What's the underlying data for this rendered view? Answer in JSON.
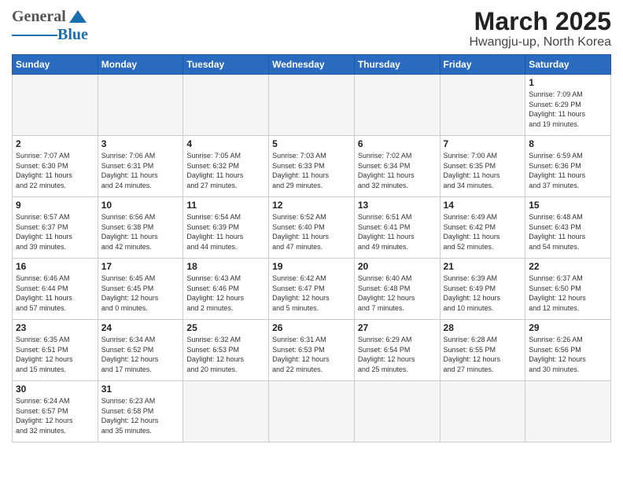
{
  "header": {
    "logo_general": "General",
    "logo_blue": "Blue",
    "title": "March 2025",
    "subtitle": "Hwangju-up, North Korea"
  },
  "weekdays": [
    "Sunday",
    "Monday",
    "Tuesday",
    "Wednesday",
    "Thursday",
    "Friday",
    "Saturday"
  ],
  "weeks": [
    [
      {
        "day": "",
        "info": ""
      },
      {
        "day": "",
        "info": ""
      },
      {
        "day": "",
        "info": ""
      },
      {
        "day": "",
        "info": ""
      },
      {
        "day": "",
        "info": ""
      },
      {
        "day": "",
        "info": ""
      },
      {
        "day": "1",
        "info": "Sunrise: 7:09 AM\nSunset: 6:29 PM\nDaylight: 11 hours\nand 19 minutes."
      }
    ],
    [
      {
        "day": "2",
        "info": "Sunrise: 7:07 AM\nSunset: 6:30 PM\nDaylight: 11 hours\nand 22 minutes."
      },
      {
        "day": "3",
        "info": "Sunrise: 7:06 AM\nSunset: 6:31 PM\nDaylight: 11 hours\nand 24 minutes."
      },
      {
        "day": "4",
        "info": "Sunrise: 7:05 AM\nSunset: 6:32 PM\nDaylight: 11 hours\nand 27 minutes."
      },
      {
        "day": "5",
        "info": "Sunrise: 7:03 AM\nSunset: 6:33 PM\nDaylight: 11 hours\nand 29 minutes."
      },
      {
        "day": "6",
        "info": "Sunrise: 7:02 AM\nSunset: 6:34 PM\nDaylight: 11 hours\nand 32 minutes."
      },
      {
        "day": "7",
        "info": "Sunrise: 7:00 AM\nSunset: 6:35 PM\nDaylight: 11 hours\nand 34 minutes."
      },
      {
        "day": "8",
        "info": "Sunrise: 6:59 AM\nSunset: 6:36 PM\nDaylight: 11 hours\nand 37 minutes."
      }
    ],
    [
      {
        "day": "9",
        "info": "Sunrise: 6:57 AM\nSunset: 6:37 PM\nDaylight: 11 hours\nand 39 minutes."
      },
      {
        "day": "10",
        "info": "Sunrise: 6:56 AM\nSunset: 6:38 PM\nDaylight: 11 hours\nand 42 minutes."
      },
      {
        "day": "11",
        "info": "Sunrise: 6:54 AM\nSunset: 6:39 PM\nDaylight: 11 hours\nand 44 minutes."
      },
      {
        "day": "12",
        "info": "Sunrise: 6:52 AM\nSunset: 6:40 PM\nDaylight: 11 hours\nand 47 minutes."
      },
      {
        "day": "13",
        "info": "Sunrise: 6:51 AM\nSunset: 6:41 PM\nDaylight: 11 hours\nand 49 minutes."
      },
      {
        "day": "14",
        "info": "Sunrise: 6:49 AM\nSunset: 6:42 PM\nDaylight: 11 hours\nand 52 minutes."
      },
      {
        "day": "15",
        "info": "Sunrise: 6:48 AM\nSunset: 6:43 PM\nDaylight: 11 hours\nand 54 minutes."
      }
    ],
    [
      {
        "day": "16",
        "info": "Sunrise: 6:46 AM\nSunset: 6:44 PM\nDaylight: 11 hours\nand 57 minutes."
      },
      {
        "day": "17",
        "info": "Sunrise: 6:45 AM\nSunset: 6:45 PM\nDaylight: 12 hours\nand 0 minutes."
      },
      {
        "day": "18",
        "info": "Sunrise: 6:43 AM\nSunset: 6:46 PM\nDaylight: 12 hours\nand 2 minutes."
      },
      {
        "day": "19",
        "info": "Sunrise: 6:42 AM\nSunset: 6:47 PM\nDaylight: 12 hours\nand 5 minutes."
      },
      {
        "day": "20",
        "info": "Sunrise: 6:40 AM\nSunset: 6:48 PM\nDaylight: 12 hours\nand 7 minutes."
      },
      {
        "day": "21",
        "info": "Sunrise: 6:39 AM\nSunset: 6:49 PM\nDaylight: 12 hours\nand 10 minutes."
      },
      {
        "day": "22",
        "info": "Sunrise: 6:37 AM\nSunset: 6:50 PM\nDaylight: 12 hours\nand 12 minutes."
      }
    ],
    [
      {
        "day": "23",
        "info": "Sunrise: 6:35 AM\nSunset: 6:51 PM\nDaylight: 12 hours\nand 15 minutes."
      },
      {
        "day": "24",
        "info": "Sunrise: 6:34 AM\nSunset: 6:52 PM\nDaylight: 12 hours\nand 17 minutes."
      },
      {
        "day": "25",
        "info": "Sunrise: 6:32 AM\nSunset: 6:53 PM\nDaylight: 12 hours\nand 20 minutes."
      },
      {
        "day": "26",
        "info": "Sunrise: 6:31 AM\nSunset: 6:53 PM\nDaylight: 12 hours\nand 22 minutes."
      },
      {
        "day": "27",
        "info": "Sunrise: 6:29 AM\nSunset: 6:54 PM\nDaylight: 12 hours\nand 25 minutes."
      },
      {
        "day": "28",
        "info": "Sunrise: 6:28 AM\nSunset: 6:55 PM\nDaylight: 12 hours\nand 27 minutes."
      },
      {
        "day": "29",
        "info": "Sunrise: 6:26 AM\nSunset: 6:56 PM\nDaylight: 12 hours\nand 30 minutes."
      }
    ],
    [
      {
        "day": "30",
        "info": "Sunrise: 6:24 AM\nSunset: 6:57 PM\nDaylight: 12 hours\nand 32 minutes."
      },
      {
        "day": "31",
        "info": "Sunrise: 6:23 AM\nSunset: 6:58 PM\nDaylight: 12 hours\nand 35 minutes."
      },
      {
        "day": "",
        "info": ""
      },
      {
        "day": "",
        "info": ""
      },
      {
        "day": "",
        "info": ""
      },
      {
        "day": "",
        "info": ""
      },
      {
        "day": "",
        "info": ""
      }
    ]
  ]
}
